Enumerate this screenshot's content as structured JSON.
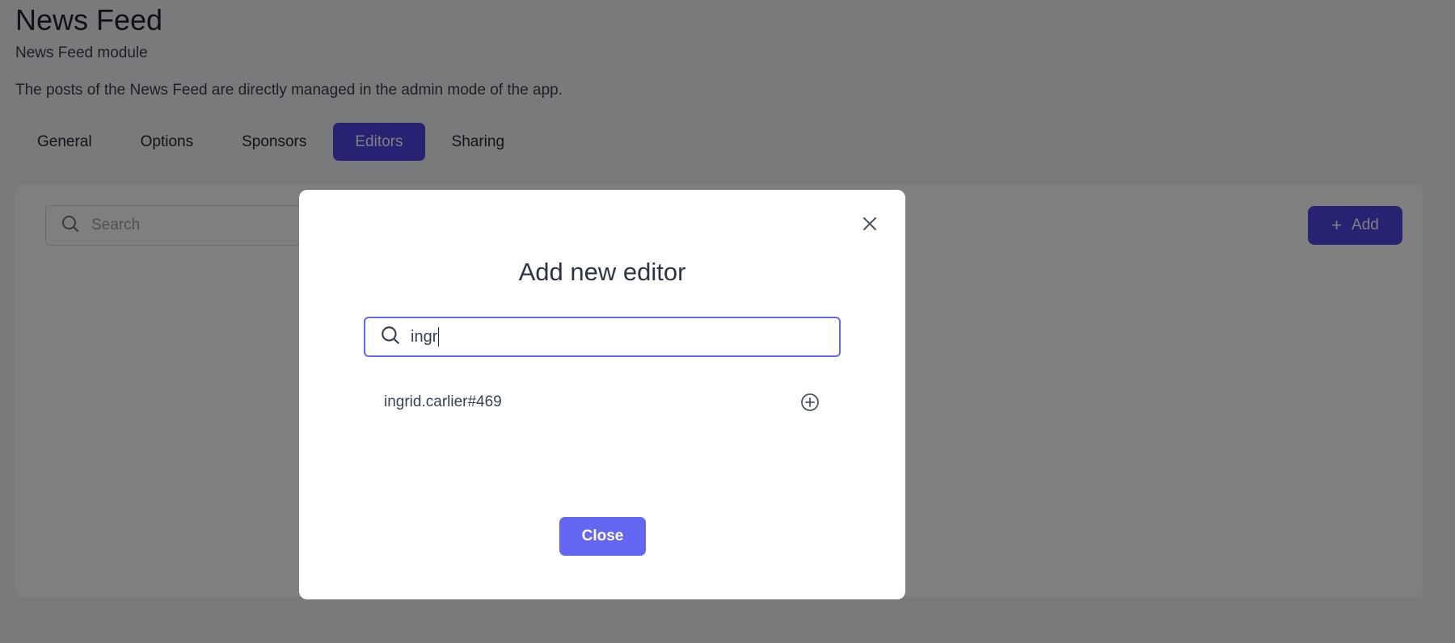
{
  "header": {
    "title": "News Feed",
    "subtitle": "News Feed module",
    "description": "The posts of the News Feed are directly managed in the admin mode of the app."
  },
  "tabs": [
    {
      "label": "General",
      "active": false
    },
    {
      "label": "Options",
      "active": false
    },
    {
      "label": "Sponsors",
      "active": false
    },
    {
      "label": "Editors",
      "active": true
    },
    {
      "label": "Sharing",
      "active": false
    }
  ],
  "card": {
    "search_placeholder": "Search",
    "add_label": "Add"
  },
  "modal": {
    "title": "Add new editor",
    "search_value": "ingr",
    "results": [
      {
        "name": "ingrid.carlier#469"
      }
    ],
    "close_label": "Close"
  },
  "colors": {
    "accent": "#4f46e5",
    "accent_light": "#6366f1",
    "overlay": "rgba(0,0,0,0.5)"
  },
  "icons": {
    "search": "search-icon",
    "close": "close-icon",
    "add_circle": "plus-circle-icon",
    "plus": "plus-icon"
  }
}
